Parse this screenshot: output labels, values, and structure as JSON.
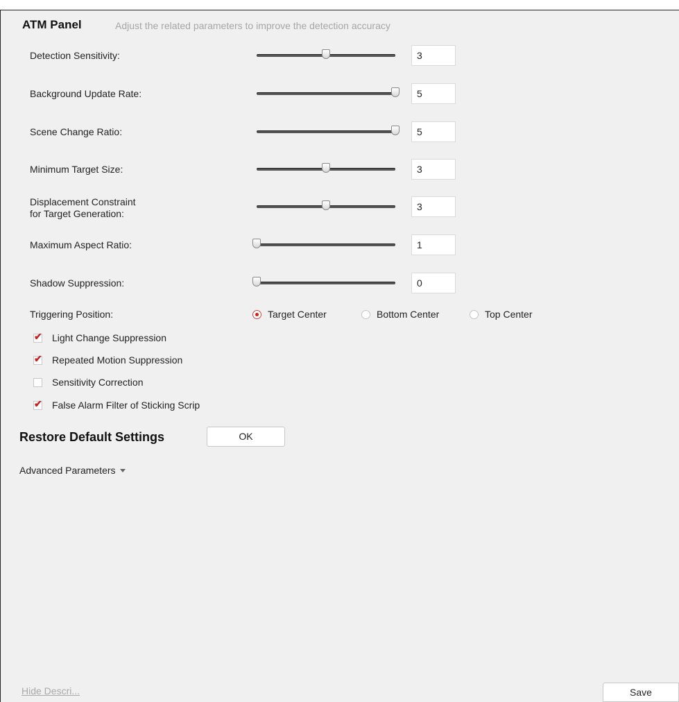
{
  "header": {
    "title": "ATM Panel",
    "subtitle": "Adjust the related parameters to improve the detection accuracy"
  },
  "sliders": [
    {
      "label": "Detection Sensitivity:",
      "value": "3",
      "fraction": 0.5
    },
    {
      "label": "Background Update Rate:",
      "value": "5",
      "fraction": 1.0
    },
    {
      "label": "Scene Change Ratio:",
      "value": "5",
      "fraction": 1.0
    },
    {
      "label": "Minimum Target Size:",
      "value": "3",
      "fraction": 0.5
    },
    {
      "label_line1": "Displacement Constraint",
      "label_line2": "for Target Generation:",
      "value": "3",
      "fraction": 0.5
    },
    {
      "label": "Maximum Aspect Ratio:",
      "value": "1",
      "fraction": 0.0
    },
    {
      "label": "Shadow Suppression:",
      "value": "0",
      "fraction": 0.0
    }
  ],
  "triggering": {
    "label": "Triggering Position:",
    "options": [
      {
        "label": "Target Center",
        "selected": true
      },
      {
        "label": "Bottom Center",
        "selected": false
      },
      {
        "label": "Top Center",
        "selected": false
      }
    ]
  },
  "checkboxes": [
    {
      "label": "Light Change Suppression",
      "checked": true
    },
    {
      "label": "Repeated Motion Suppression",
      "checked": true
    },
    {
      "label": "Sensitivity Correction",
      "checked": false
    },
    {
      "label": "False Alarm Filter of Sticking Scrip",
      "checked": true
    }
  ],
  "restore": {
    "label": "Restore Default Settings",
    "button": "OK"
  },
  "advanced": {
    "label": "Advanced Parameters"
  },
  "footer": {
    "hide_link": "Hide Descri...",
    "save_button": "Save"
  },
  "colors": {
    "accent": "#d02020",
    "panel_bg": "#f0f0f0",
    "muted_text": "#a6a6a6"
  }
}
